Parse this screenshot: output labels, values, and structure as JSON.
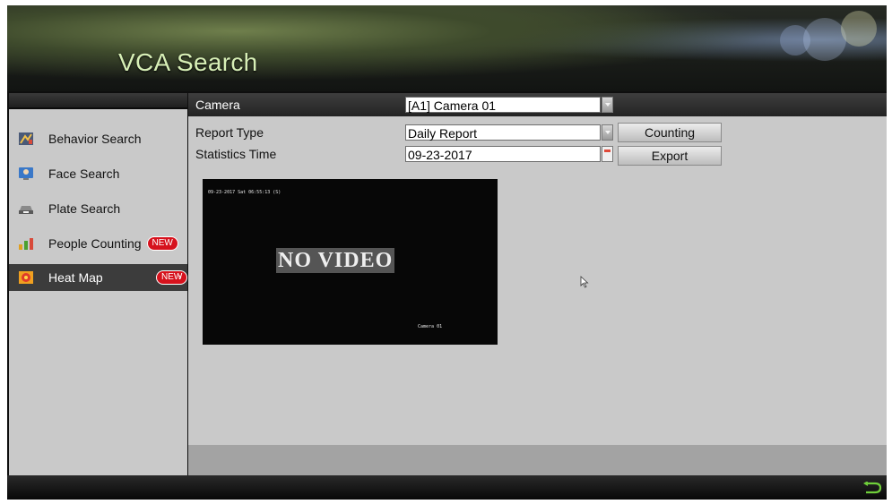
{
  "title": "VCA Search",
  "sidebar": {
    "items": [
      {
        "label": "Behavior Search",
        "icon": "behavior-search-icon"
      },
      {
        "label": "Face Search",
        "icon": "face-search-icon"
      },
      {
        "label": "Plate Search",
        "icon": "plate-search-icon"
      },
      {
        "label": "People Counting",
        "icon": "people-counting-icon",
        "badge": "NEW"
      },
      {
        "label": "Heat Map",
        "icon": "heat-map-icon",
        "badge": "NEW",
        "active": true
      }
    ]
  },
  "form": {
    "camera_label": "Camera",
    "camera_value": "[A1] Camera 01",
    "report_type_label": "Report Type",
    "report_type_value": "Daily Report",
    "statistics_time_label": "Statistics Time",
    "statistics_time_value": "09-23-2017"
  },
  "buttons": {
    "counting": "Counting",
    "export": "Export"
  },
  "video": {
    "timestamp": "09-23-2017 Sat 06:55:13 (S)",
    "message": "NO VIDEO",
    "camera_name": "Camera 01"
  },
  "colors": {
    "title": "#d7efb6",
    "badge": "#d6121d",
    "active_item": "#3c3c3c",
    "back_arrow": "#6fcf3a"
  }
}
